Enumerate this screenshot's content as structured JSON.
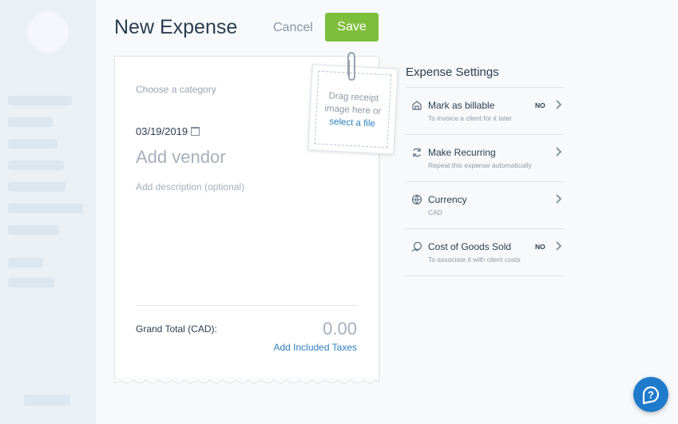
{
  "header": {
    "title": "New Expense",
    "cancel_label": "Cancel",
    "save_label": "Save"
  },
  "colors": {
    "save": "#7dbe3a",
    "link": "#2f7fc1",
    "help": "#1f7acc"
  },
  "receipt": {
    "category_placeholder": "Choose a category",
    "date": "03/19/2019",
    "vendor_placeholder": "Add vendor",
    "description_placeholder": "Add description (optional)",
    "grand_total_label": "Grand Total (CAD):",
    "grand_total_value": "0.00",
    "add_taxes_label": "Add Included Taxes"
  },
  "upload": {
    "text_1": "Drag receipt",
    "text_2": "image here or",
    "link": "select a file"
  },
  "settings": {
    "title": "Expense Settings",
    "rows": [
      {
        "label": "Mark as billable",
        "sub": "To invoice a client for it later",
        "badge": "NO",
        "icon": "billable-icon"
      },
      {
        "label": "Make Recurring",
        "sub": "Repeat this expense automatically",
        "badge": "",
        "icon": "recurring-icon"
      },
      {
        "label": "Currency",
        "sub": "CAD",
        "badge": "",
        "icon": "currency-icon"
      },
      {
        "label": "Cost of Goods Sold",
        "sub": "To associate it with client costs",
        "badge": "NO",
        "icon": "cost-of-goods-icon"
      }
    ]
  },
  "help": {
    "label": "?"
  }
}
